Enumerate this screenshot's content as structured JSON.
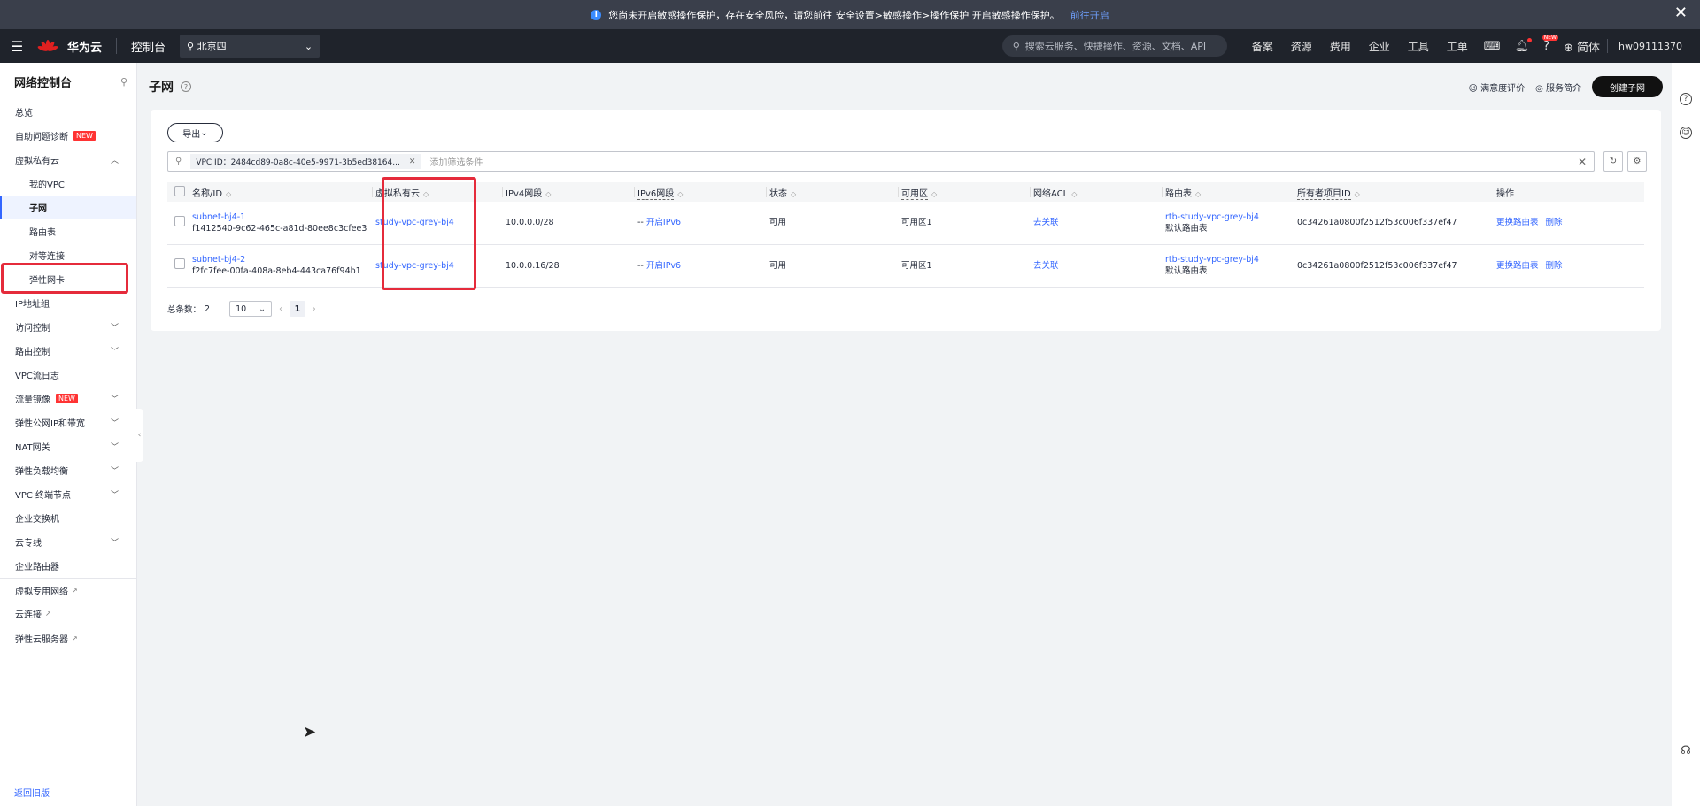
{
  "banner": {
    "text": "您尚未开启敏感操作保护，存在安全风险，请您前往 安全设置>敏感操作>操作保护 开启敏感操作保护。",
    "link": "前往开启",
    "close": "✕"
  },
  "topnav": {
    "brand": "华为云",
    "brand_small": "HUAWEI",
    "console": "控制台",
    "region": "北京四",
    "search_placeholder": "搜索云服务、快捷操作、资源、文档、API",
    "links": [
      "备案",
      "资源",
      "费用",
      "企业",
      "工具",
      "工单"
    ],
    "new_badge": "NEW",
    "lang": "简体",
    "user": "hw09111370"
  },
  "sidebar": {
    "title": "网络控制台",
    "items": [
      {
        "label": "总览"
      },
      {
        "label": "自助问题诊断",
        "badge": "NEW"
      },
      {
        "label": "虚拟私有云"
      },
      {
        "label": "我的VPC"
      },
      {
        "label": "子网"
      },
      {
        "label": "路由表"
      },
      {
        "label": "对等连接"
      },
      {
        "label": "弹性网卡"
      },
      {
        "label": "IP地址组"
      },
      {
        "label": "访问控制"
      },
      {
        "label": "路由控制"
      },
      {
        "label": "VPC流日志"
      },
      {
        "label": "流量镜像",
        "badge": "NEW"
      },
      {
        "label": "弹性公网IP和带宽"
      },
      {
        "label": "NAT网关"
      },
      {
        "label": "弹性负载均衡"
      },
      {
        "label": "VPC 终端节点"
      },
      {
        "label": "企业交换机"
      },
      {
        "label": "云专线"
      },
      {
        "label": "企业路由器"
      },
      {
        "label": "虚拟专用网络"
      },
      {
        "label": "云连接"
      },
      {
        "label": "弹性云服务器"
      }
    ],
    "old_version": "返回旧版"
  },
  "page": {
    "title": "子网",
    "feedback": "满意度评价",
    "intro": "服务简介",
    "create": "创建子网"
  },
  "toolbar": {
    "export": "导出",
    "filter_chip": "VPC ID：2484cd89-0a8c-40e5-9971-3b5ed38164...",
    "filter_placeholder": "添加筛选条件"
  },
  "table": {
    "columns": [
      "名称/ID",
      "虚拟私有云",
      "IPv4网段",
      "IPv6网段",
      "状态",
      "可用区",
      "网络ACL",
      "路由表",
      "所有者项目ID",
      "操作"
    ],
    "rows": [
      {
        "name": "subnet-bj4-1",
        "id": "f1412540-9c62-465c-a81d-80ee8c3cfee3",
        "vpc": "study-vpc-grey-bj4",
        "ipv4": "10.0.0.0/28",
        "ipv6_prefix": "--",
        "ipv6": "开启IPv6",
        "status": "可用",
        "az": "可用区1",
        "acl": "去关联",
        "route_table": "rtb-study-vpc-grey-bj4",
        "route_default": "默认路由表",
        "project": "0c34261a0800f2512f53c006f337ef47",
        "op1": "更换路由表",
        "op2": "删除"
      },
      {
        "name": "subnet-bj4-2",
        "id": "f2fc7fee-00fa-408a-8eb4-443ca76f94b1",
        "vpc": "study-vpc-grey-bj4",
        "ipv4": "10.0.0.16/28",
        "ipv6_prefix": "--",
        "ipv6": "开启IPv6",
        "status": "可用",
        "az": "可用区1",
        "acl": "去关联",
        "route_table": "rtb-study-vpc-grey-bj4",
        "route_default": "默认路由表",
        "project": "0c34261a0800f2512f53c006f337ef47",
        "op1": "更换路由表",
        "op2": "删除"
      }
    ]
  },
  "pager": {
    "total_label": "总条数：",
    "total": "2",
    "page_size": "10",
    "current": "1"
  }
}
